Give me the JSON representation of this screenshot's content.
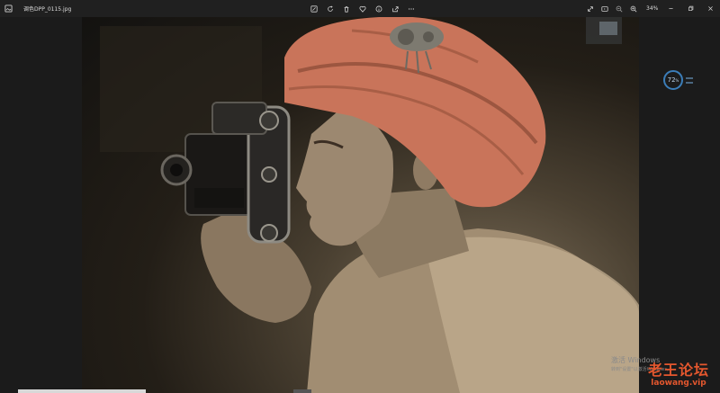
{
  "window": {
    "filename": "调色DPP_0115.jpg",
    "zoom": "34%"
  },
  "toolbar": {
    "items": [
      "edit-icon",
      "rotate-icon",
      "delete-icon",
      "favorite-icon",
      "info-icon",
      "share-icon",
      "more-icon"
    ]
  },
  "right_tools": {
    "items": [
      "fullscreen-icon",
      "slideshow-icon",
      "zoom-out-icon",
      "zoom-in-icon"
    ]
  },
  "perf_widget": {
    "value": "72",
    "unit": "%"
  },
  "activation": {
    "line1": "激活 Windows",
    "line2": "转到\"设置\"以激活Windows。"
  },
  "watermark": {
    "line1": "老王论坛",
    "line2": "laowang.vip"
  },
  "colors": {
    "background": "#1b1b1b",
    "titlebar": "#202020",
    "turban": "#c9745a",
    "watermark": "#e4572e"
  }
}
